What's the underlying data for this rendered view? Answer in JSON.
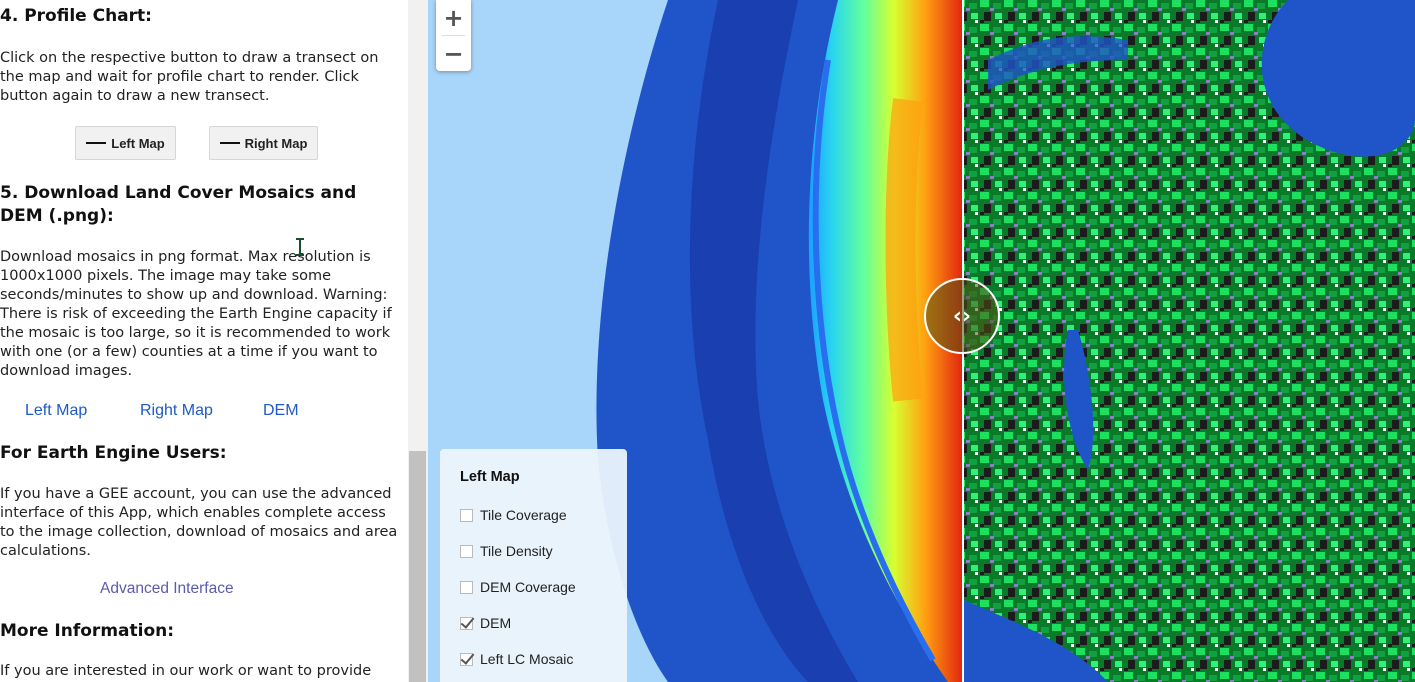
{
  "sidebar": {
    "profile_heading": "4. Profile Chart:",
    "profile_text": "Click on the respective button to draw a transect on the map and wait for profile chart to render. Click button again to draw a new transect.",
    "left_map_button": "Left Map",
    "right_map_button": "Right Map",
    "download_heading": "5. Download Land Cover Mosaics and DEM (.png):",
    "download_text": "Download mosaics in png format. Max resolution is 1000x1000 pixels. The image may take some seconds/minutes to show up and download. Warning: There is risk of exceeding the Earth Engine capacity if the mosaic is too large, so it is recommended to work with one (or a few) counties at a time if you want to download images.",
    "download_links": [
      "Left Map",
      "Right Map",
      "DEM"
    ],
    "gee_heading": "For Earth Engine Users:",
    "gee_text": "If you have a GEE account, you can use the advanced interface of this App, which enables complete access to the image collection, download of mosaics and area calculations.",
    "advanced_link": "Advanced Interface",
    "more_heading": "More Information:",
    "more_text": "If you are interested in our work or want to provide"
  },
  "map": {
    "zoom_in": "+",
    "zoom_out": "−",
    "legend": {
      "title": "Left Map",
      "items": [
        {
          "label": "Tile Coverage",
          "checked": false
        },
        {
          "label": "Tile Density",
          "checked": false
        },
        {
          "label": "DEM Coverage",
          "checked": false
        },
        {
          "label": "DEM",
          "checked": true
        },
        {
          "label": "Left LC Mosaic",
          "checked": true
        }
      ]
    },
    "swipe_icon": "‹›"
  },
  "colors": {
    "link_blue": "#1e5ac8",
    "link_purple": "#5b5baf",
    "ocean": "#1f55c9"
  }
}
